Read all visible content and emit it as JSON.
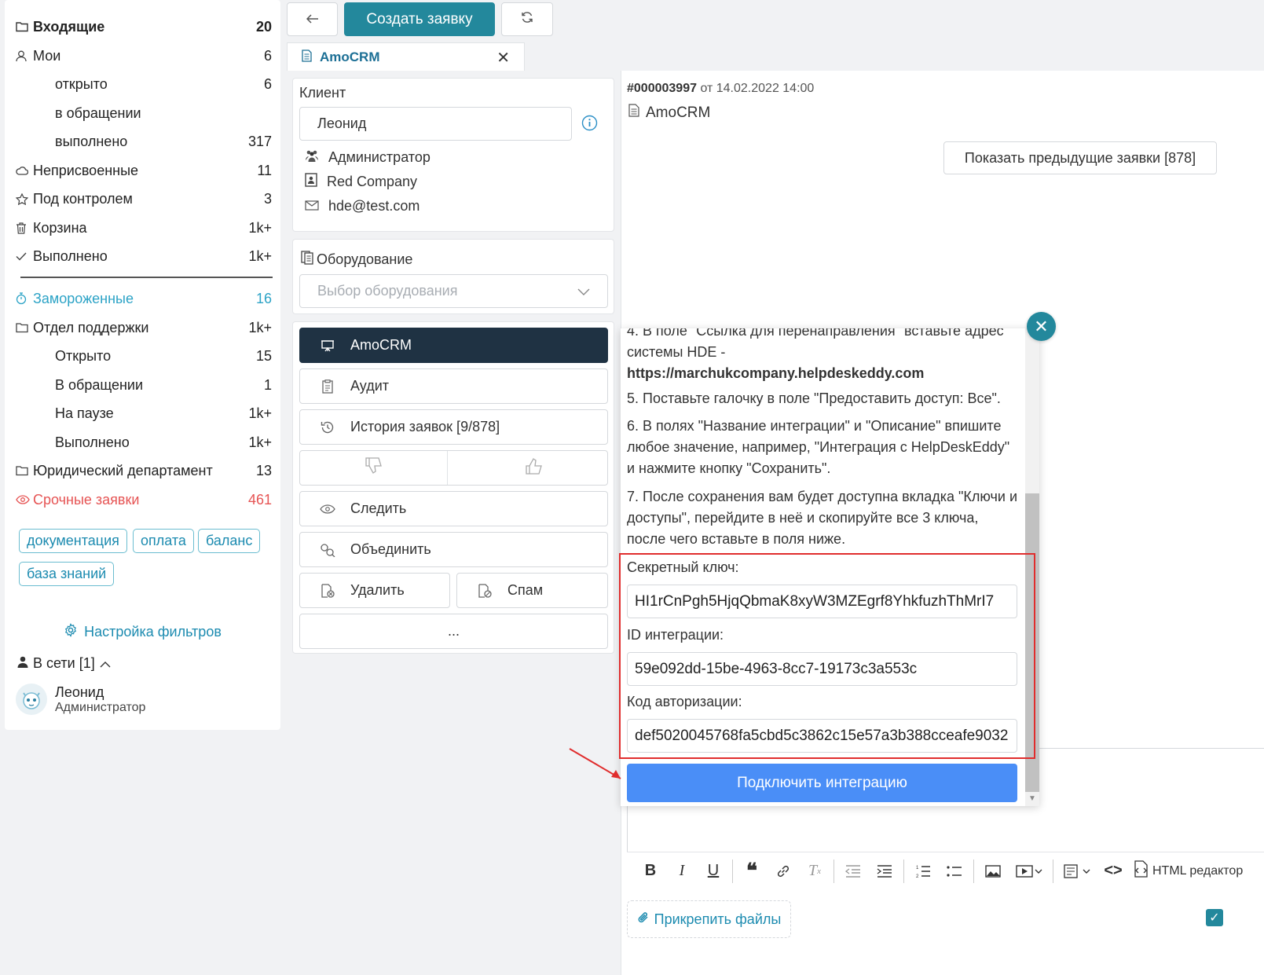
{
  "sidebar": {
    "items": [
      {
        "label": "Входящие",
        "count": "20",
        "icon": "folder-icon"
      },
      {
        "label": "Мои",
        "count": "6",
        "icon": "user-icon"
      },
      {
        "label": "открыто",
        "count": "6"
      },
      {
        "label": "в обращении",
        "count": ""
      },
      {
        "label": "выполнено",
        "count": "317"
      },
      {
        "label": "Неприсвоенные",
        "count": "11",
        "icon": "cloud-icon"
      },
      {
        "label": "Под контролем",
        "count": "3",
        "icon": "star-icon"
      },
      {
        "label": "Корзина",
        "count": "1k+",
        "icon": "trash-icon"
      },
      {
        "label": "Выполнено",
        "count": "1k+",
        "icon": "check-icon"
      },
      {
        "label": "Замороженные",
        "count": "16",
        "icon": "timer-icon"
      },
      {
        "label": "Отдел поддержки",
        "count": "1k+",
        "icon": "folder-icon"
      },
      {
        "label": "Открыто",
        "count": "15"
      },
      {
        "label": "В обращении",
        "count": "1"
      },
      {
        "label": "На паузе",
        "count": "1k+"
      },
      {
        "label": "Выполнено",
        "count": "1k+"
      },
      {
        "label": "Юридический департамент",
        "count": "13",
        "icon": "folder-icon"
      },
      {
        "label": "Срочные заявки",
        "count": "461",
        "icon": "eye-icon"
      }
    ],
    "tags": [
      "документация",
      "оплата",
      "баланс",
      "база знаний"
    ],
    "filter_settings": "Настройка фильтров",
    "online": "В сети [1]",
    "user": {
      "name": "Леонид",
      "role": "Администратор"
    }
  },
  "toolbar": {
    "create_label": "Создать заявку"
  },
  "tab": {
    "label": "AmoCRM"
  },
  "client": {
    "section_label": "Клиент",
    "name": "Леонид",
    "role": "Администратор",
    "company": "Red Company",
    "email": "hde@test.com"
  },
  "equipment": {
    "label": "Оборудование",
    "placeholder": "Выбор оборудования"
  },
  "actions": {
    "amocrm": "AmoCRM",
    "audit": "Аудит",
    "history": "История заявок [9/878]",
    "follow": "Следить",
    "merge": "Объединить",
    "delete": "Удалить",
    "spam": "Спам",
    "more": "..."
  },
  "ticket": {
    "number": "#000003997",
    "date": "от 14.02.2022 14:00",
    "title": "AmoCRM",
    "prev_button": "Показать предыдущие заявки [878]"
  },
  "modal": {
    "step4_partial": "4. В поле \"Ссылка для перенаправления\" вставьте адрес",
    "step4_line2": "системы HDE -",
    "step4_url": "https://marchukcompany.helpdeskeddy.com",
    "step5": "5. Поставьте галочку в поле \"Предоставить доступ: Все\".",
    "step6": "6. В полях \"Название интеграции\" и \"Описание\" впишите любое значение, например, \"Интеграция с HelpDeskEddy\" и нажмите кнопку \"Сохранить\".",
    "step7": "7. После сохранения вам будет доступна вкладка \"Ключи и доступы\", перейдите в неё и скопируйте все 3 ключа, после чего вставьте в поля ниже.",
    "secret_label": "Секретный ключ:",
    "secret_value": "HI1rCnPgh5HjqQbmaK8xyW3MZEgrf8YhkfuzhThMrI7",
    "id_label": "ID интеграции:",
    "id_value": "59e092dd-15be-4963-8cc7-19173c3a553c",
    "auth_label": "Код авторизации:",
    "auth_value": "def5020045768fa5cbd5c3862c15e57a3b388cceafe9032",
    "connect_button": "Подключить интеграцию"
  },
  "editor": {
    "html_editor": "HTML редактор",
    "attach": "Прикрепить файлы"
  }
}
